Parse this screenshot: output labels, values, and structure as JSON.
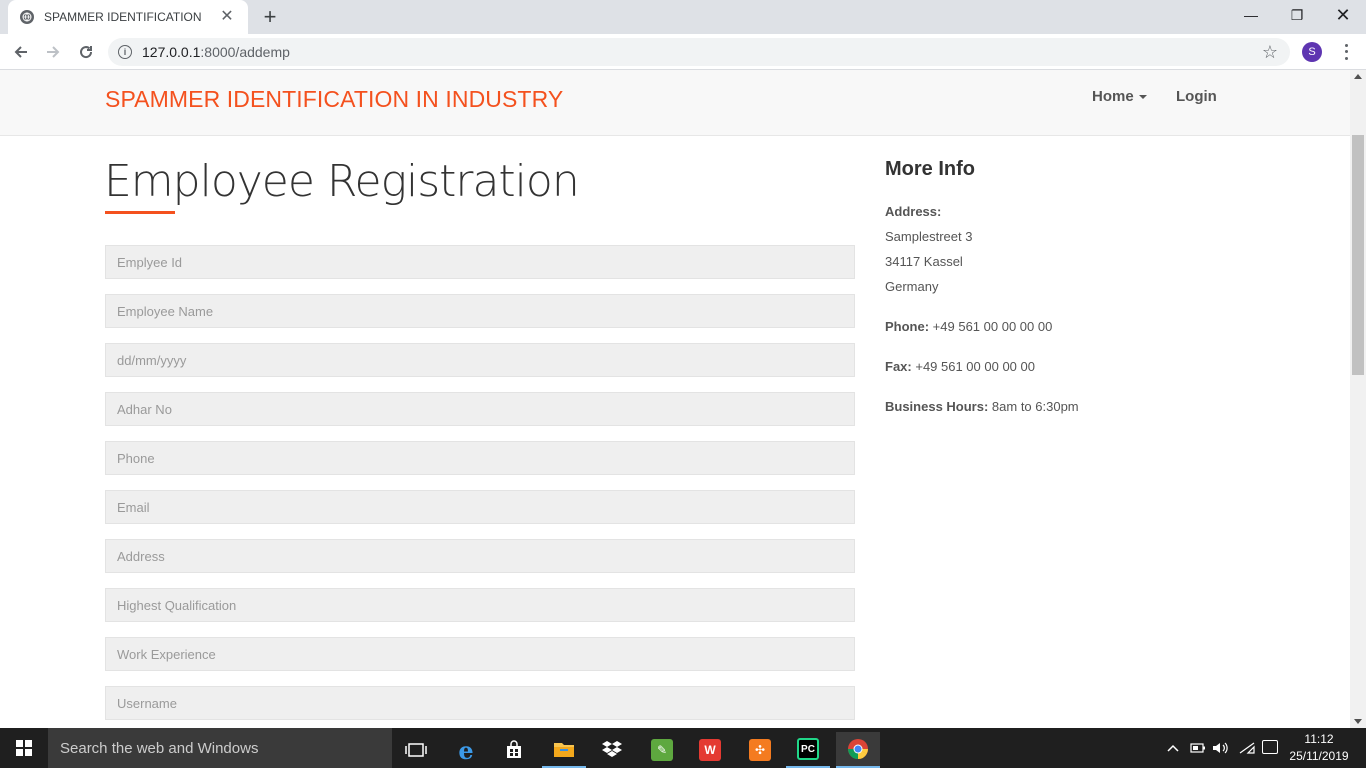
{
  "browser": {
    "tab_title": "SPAMMER IDENTIFICATION",
    "url_host": "127.0.0.1",
    "url_path": ":8000/addemp",
    "profile_initial": "S"
  },
  "site": {
    "brand": "SPAMMER IDENTIFICATION IN INDUSTRY",
    "nav": {
      "home": "Home",
      "login": "Login"
    }
  },
  "page": {
    "title": "Employee Registration",
    "fields": [
      {
        "placeholder": "Emplyee Id"
      },
      {
        "placeholder": "Employee Name"
      },
      {
        "placeholder": "dd/mm/yyyy"
      },
      {
        "placeholder": "Adhar No"
      },
      {
        "placeholder": "Phone"
      },
      {
        "placeholder": "Email"
      },
      {
        "placeholder": "Address"
      },
      {
        "placeholder": "Highest Qualification"
      },
      {
        "placeholder": "Work Experience"
      },
      {
        "placeholder": "Username"
      }
    ]
  },
  "more_info": {
    "heading": "More Info",
    "address_label": "Address:",
    "address_lines": [
      "Samplestreet 3",
      "34117 Kassel",
      "Germany"
    ],
    "phone_label": "Phone:",
    "phone": " +49 561 00 00 00 00",
    "fax_label": "Fax:",
    "fax": " +49 561 00 00 00 00",
    "hours_label": "Business Hours:",
    "hours": " 8am to 6:30pm"
  },
  "taskbar": {
    "search_placeholder": "Search the web and Windows",
    "time": "11:12",
    "date": "25/11/2019"
  },
  "colors": {
    "brand": "#f4511e",
    "accent_underline": "#f4511e"
  }
}
